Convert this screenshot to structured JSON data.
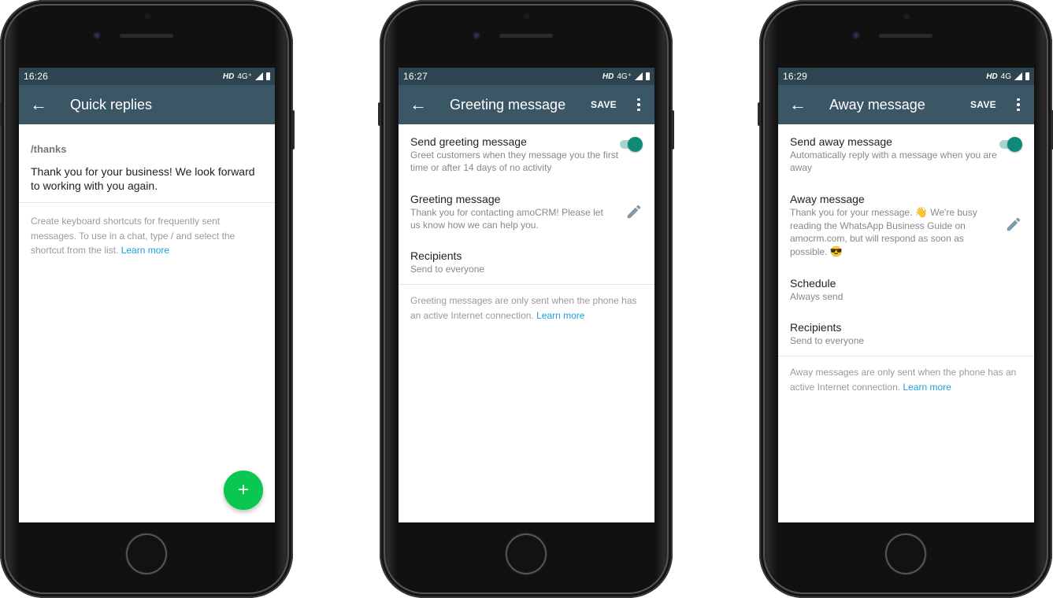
{
  "phones": [
    {
      "status": {
        "time": "16:26",
        "hd": "HD",
        "network": "4G⁺"
      },
      "toolbar": {
        "title": "Quick replies"
      },
      "quick_reply": {
        "shortcut": "/thanks",
        "message": "Thank you for your business! We look forward to working with you again."
      },
      "hint": {
        "text": "Create keyboard shortcuts for frequently sent messages. To use in a chat, type / and select the shortcut from the list. ",
        "link": "Learn more"
      },
      "fab": {
        "icon": "plus-icon",
        "label": "+"
      }
    },
    {
      "status": {
        "time": "16:27",
        "hd": "HD",
        "network": "4G⁺"
      },
      "toolbar": {
        "title": "Greeting message",
        "save_label": "SAVE"
      },
      "settings": [
        {
          "label": "Send greeting message",
          "sub": "Greet customers when they message you the first time or after 14 days of no activity",
          "toggle": true
        },
        {
          "label": "Greeting message",
          "sub": "Thank you for contacting amoCRM! Please let us know how we can help you.",
          "editable": true
        },
        {
          "label": "Recipients",
          "sub": "Send to everyone"
        }
      ],
      "hint": {
        "text": "Greeting messages are only sent when the phone has an active Internet connection. ",
        "link": "Learn more"
      }
    },
    {
      "status": {
        "time": "16:29",
        "hd": "HD",
        "network": "4G"
      },
      "toolbar": {
        "title": "Away message",
        "save_label": "SAVE"
      },
      "settings": [
        {
          "label": "Send away message",
          "sub": "Automatically reply with a message when you are away",
          "toggle": true
        },
        {
          "label": "Away message",
          "sub_parts": [
            "Thank you for your message. ",
            "👋",
            " We're busy reading the WhatsApp Business Guide on amocrm.com, but will respond as soon as possible. ",
            "😎"
          ],
          "editable": true
        },
        {
          "label": "Schedule",
          "sub": "Always send"
        },
        {
          "label": "Recipients",
          "sub": "Send to everyone"
        }
      ],
      "hint": {
        "text": "Away messages are only sent when the phone has an active Internet connection. ",
        "link": "Learn more"
      }
    }
  ],
  "colors": {
    "statusbar": "#2e4451",
    "toolbar": "#3b5765",
    "toggle_on": "#0f8a78",
    "link": "#1a9fe0",
    "fab": "#0ac751"
  }
}
